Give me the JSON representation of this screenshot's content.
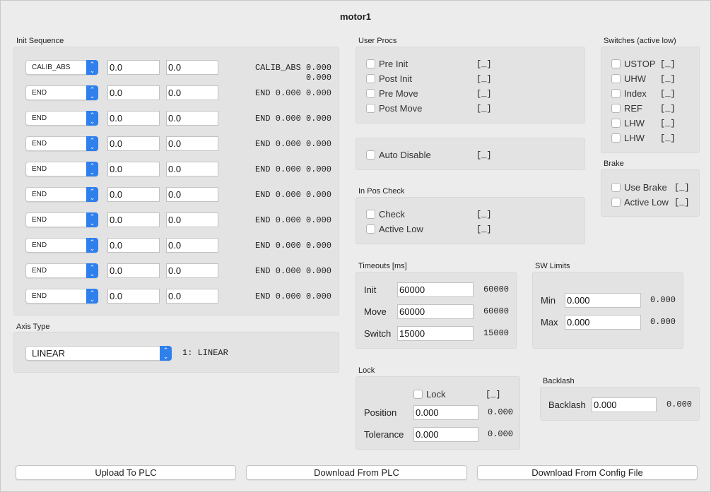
{
  "window": {
    "title": "motor1"
  },
  "init_sequence": {
    "label": "Init Sequence",
    "rows": [
      {
        "mode": "CALIB_ABS",
        "v1": "0.0",
        "v2": "0.0",
        "readout": "CALIB_ABS 0.000 0.000"
      },
      {
        "mode": "END",
        "v1": "0.0",
        "v2": "0.0",
        "readout": "END 0.000 0.000"
      },
      {
        "mode": "END",
        "v1": "0.0",
        "v2": "0.0",
        "readout": "END 0.000 0.000"
      },
      {
        "mode": "END",
        "v1": "0.0",
        "v2": "0.0",
        "readout": "END 0.000 0.000"
      },
      {
        "mode": "END",
        "v1": "0.0",
        "v2": "0.0",
        "readout": "END 0.000 0.000"
      },
      {
        "mode": "END",
        "v1": "0.0",
        "v2": "0.0",
        "readout": "END 0.000 0.000"
      },
      {
        "mode": "END",
        "v1": "0.0",
        "v2": "0.0",
        "readout": "END 0.000 0.000"
      },
      {
        "mode": "END",
        "v1": "0.0",
        "v2": "0.0",
        "readout": "END 0.000 0.000"
      },
      {
        "mode": "END",
        "v1": "0.0",
        "v2": "0.0",
        "readout": "END 0.000 0.000"
      },
      {
        "mode": "END",
        "v1": "0.0",
        "v2": "0.0",
        "readout": "END 0.000 0.000"
      }
    ]
  },
  "axis_type": {
    "label": "Axis Type",
    "selected": "LINEAR",
    "readout": "1: LINEAR"
  },
  "user_procs": {
    "label": "User Procs",
    "items": [
      {
        "label": "Pre Init",
        "status": "[_]"
      },
      {
        "label": "Post Init",
        "status": "[_]"
      },
      {
        "label": "Pre Move",
        "status": "[_]"
      },
      {
        "label": "Post Move",
        "status": "[_]"
      }
    ]
  },
  "auto_disable": {
    "label": "Auto Disable",
    "status": "[_]"
  },
  "in_pos_check": {
    "label": "In Pos Check",
    "items": [
      {
        "label": "Check",
        "status": "[_]"
      },
      {
        "label": "Active Low",
        "status": "[_]"
      }
    ]
  },
  "switches": {
    "label": "Switches (active low)",
    "items": [
      {
        "label": "USTOP",
        "status": "[_]"
      },
      {
        "label": "UHW",
        "status": "[_]"
      },
      {
        "label": "Index",
        "status": "[_]"
      },
      {
        "label": "REF",
        "status": "[_]"
      },
      {
        "label": "LHW",
        "status": "[_]"
      },
      {
        "label": "LHW",
        "status": "[_]"
      }
    ]
  },
  "brake": {
    "label": "Brake",
    "items": [
      {
        "label": "Use Brake",
        "status": "[_]"
      },
      {
        "label": "Active Low",
        "status": "[_]"
      }
    ]
  },
  "timeouts": {
    "label": "Timeouts [ms]",
    "rows": [
      {
        "label": "Init",
        "value": "60000",
        "readout": "60000"
      },
      {
        "label": "Move",
        "value": "60000",
        "readout": "60000"
      },
      {
        "label": "Switch",
        "value": "15000",
        "readout": "15000"
      }
    ]
  },
  "sw_limits": {
    "label": "SW Limits",
    "rows": [
      {
        "label": "Min",
        "value": "0.000",
        "readout": "0.000"
      },
      {
        "label": "Max",
        "value": "0.000",
        "readout": "0.000"
      }
    ]
  },
  "lock": {
    "label": "Lock",
    "lock_label": "Lock",
    "lock_status": "[_]",
    "rows": [
      {
        "label": "Position",
        "value": "0.000",
        "readout": "0.000"
      },
      {
        "label": "Tolerance",
        "value": "0.000",
        "readout": "0.000"
      }
    ]
  },
  "backlash": {
    "label": "Backlash",
    "field_label": "Backlash",
    "value": "0.000",
    "readout": "0.000"
  },
  "buttons": {
    "upload": "Upload To PLC",
    "download_plc": "Download From PLC",
    "download_config": "Download From Config File"
  },
  "colors": {
    "accent": "#2f80ed",
    "window_bg": "#ececec",
    "group_bg": "#e3e3e3"
  },
  "icons": {
    "combo_arrow": "chevron-up-down-icon",
    "checkbox": "checkbox-icon"
  }
}
